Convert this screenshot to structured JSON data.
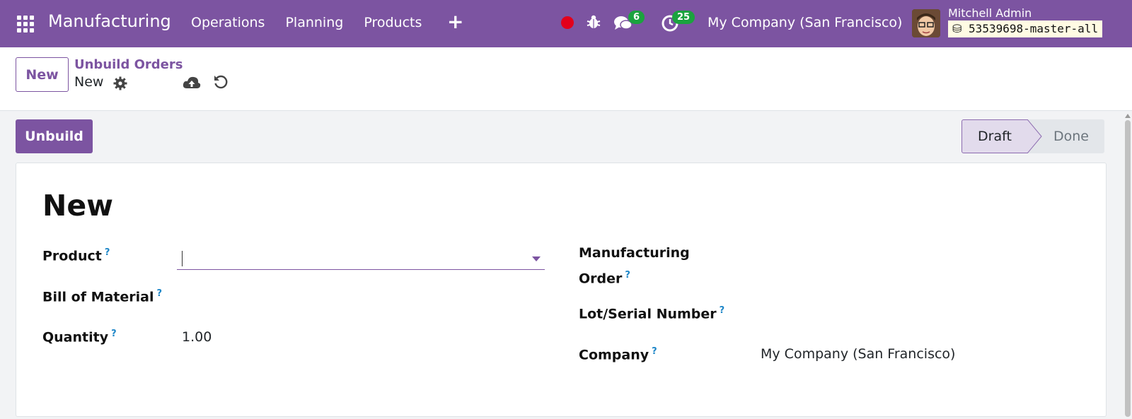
{
  "navbar": {
    "app_name": "Manufacturing",
    "menu": [
      "Operations",
      "Planning",
      "Products"
    ],
    "plus_label": "+",
    "chat_count": "6",
    "activity_count": "25",
    "company": "My Company (San Francisco)",
    "user": "Mitchell Admin",
    "database": "53539698-master-all",
    "accent_color": "#7c54a1"
  },
  "control_panel": {
    "new_label": "New",
    "breadcrumb": "Unbuild Orders",
    "record_name": "New"
  },
  "statusbar": {
    "action_label": "Unbuild",
    "stages": [
      "Draft",
      "Done"
    ],
    "current_stage": "Draft"
  },
  "form": {
    "title": "New",
    "help_marker": "?",
    "fields": {
      "product": {
        "label": "Product",
        "value": ""
      },
      "bom": {
        "label": "Bill of Material",
        "value": ""
      },
      "quantity": {
        "label": "Quantity",
        "value": "1.00"
      },
      "mo_line1": "Manufacturing",
      "mo_line2": "Order",
      "lot": {
        "label": "Lot/Serial Number",
        "value": ""
      },
      "company": {
        "label": "Company",
        "value": "My Company (San Francisco)"
      }
    }
  }
}
